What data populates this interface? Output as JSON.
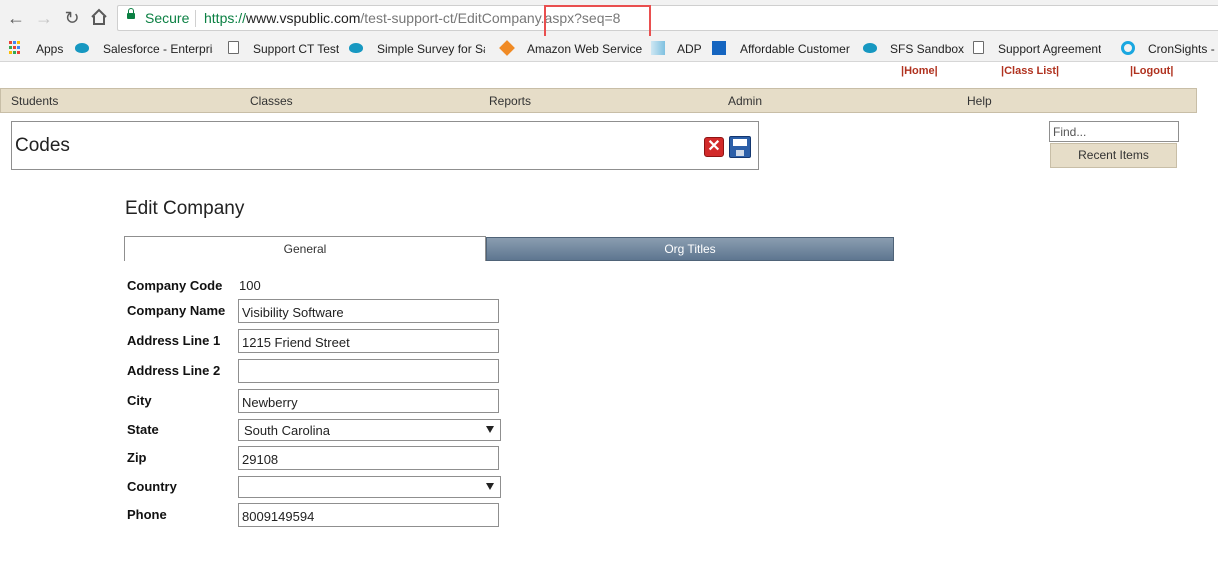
{
  "browser": {
    "secure_label": "Secure",
    "url_scheme": "https://",
    "url_host": "www.vspublic.com",
    "url_path": "/test-support-ct/EditCompany.aspx?seq=8",
    "highlight_color": "#e94f4f"
  },
  "bookmarks": [
    {
      "label": "Apps",
      "icon": "apps-grid-icon"
    },
    {
      "label": "Salesforce - Enterpris",
      "icon": "salesforce-cloud-icon"
    },
    {
      "label": "Support CT Test",
      "icon": "page-icon"
    },
    {
      "label": "Simple Survey for Sa",
      "icon": "salesforce-cloud-icon"
    },
    {
      "label": "Amazon Web Service",
      "icon": "aws-cube-icon"
    },
    {
      "label": "ADP",
      "icon": "adp-icon"
    },
    {
      "label": "Affordable Customer",
      "icon": "affordable-arrow-icon"
    },
    {
      "label": "SFS Sandbox",
      "icon": "salesforce-cloud-icon"
    },
    {
      "label": "Support Agreement",
      "icon": "page-icon"
    },
    {
      "label": "CronSights -",
      "icon": "cronsights-icon"
    }
  ],
  "toplinks": {
    "home": "|Home|",
    "class_list": "|Class List|",
    "logout": "|Logout|"
  },
  "menu": {
    "students": "Students",
    "classes": "Classes",
    "reports": "Reports",
    "admin": "Admin",
    "help": "Help"
  },
  "codes_panel": {
    "title": "Codes",
    "cancel_glyph": "✕"
  },
  "find": {
    "placeholder": "Find...",
    "recent_label": "Recent Items"
  },
  "form": {
    "title": "Edit Company",
    "tabs": {
      "general": "General",
      "org_titles": "Org Titles"
    },
    "labels": {
      "company_code": "Company Code",
      "company_name": "Company Name",
      "address1": "Address Line 1",
      "address2": "Address Line 2",
      "city": "City",
      "state": "State",
      "zip": "Zip",
      "country": "Country",
      "phone": "Phone"
    },
    "values": {
      "company_code": "100",
      "company_name": "Visibility Software",
      "address1": "1215 Friend Street",
      "address2": "",
      "city": "Newberry",
      "state": "South Carolina",
      "zip": "29108",
      "country": "",
      "phone": "8009149594"
    }
  },
  "colors": {
    "menubar_bg": "#e6ddc8",
    "link_red": "#b0321f",
    "tab_active_bg": "#5e7690"
  }
}
